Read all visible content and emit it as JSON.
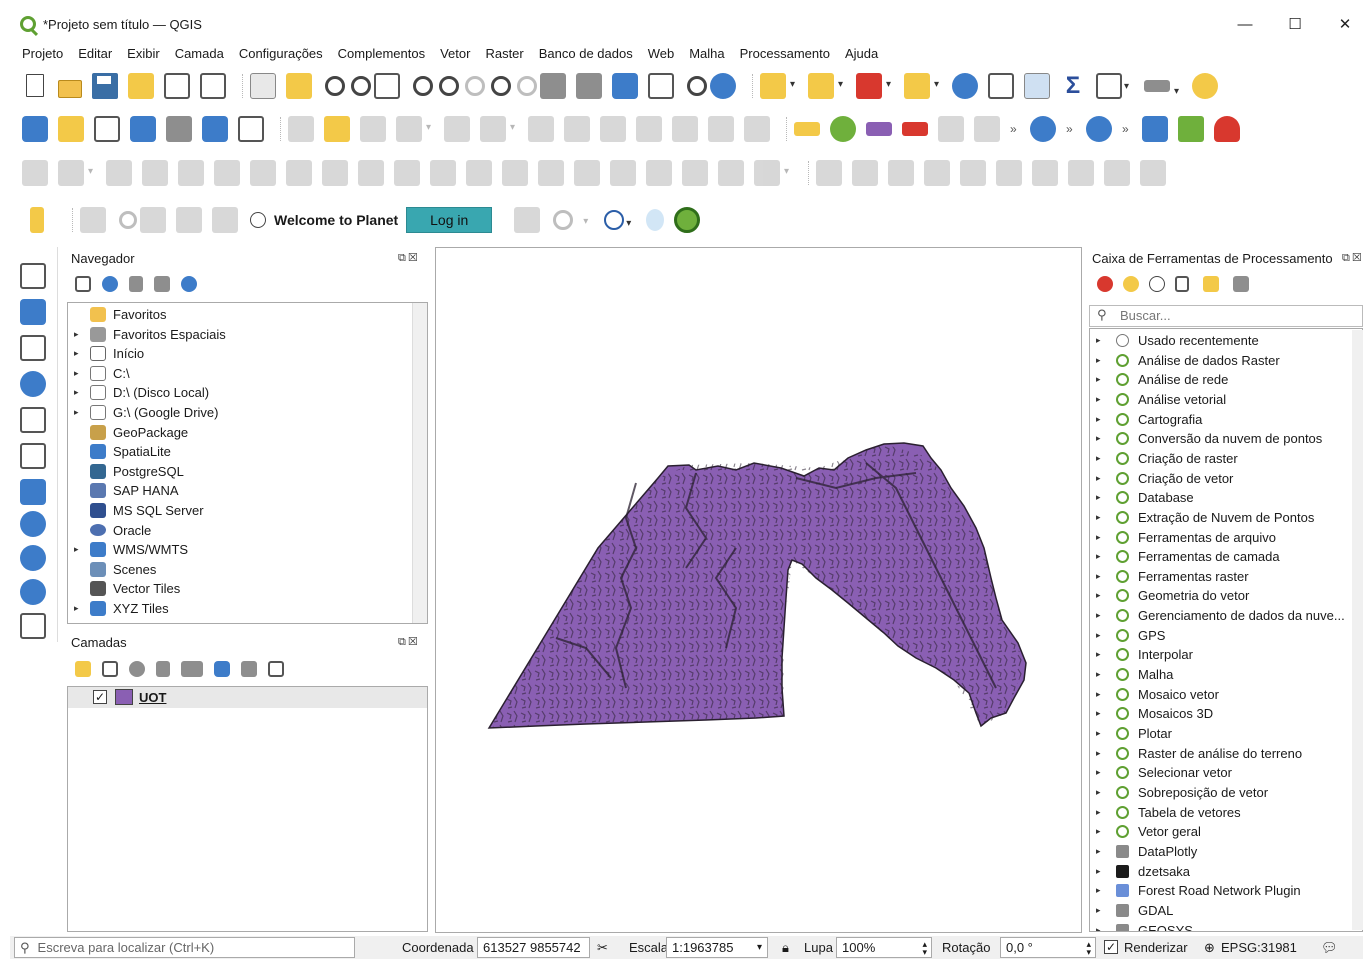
{
  "window": {
    "title": "*Projeto sem título — QGIS",
    "minimize": "—",
    "maximize": "☐",
    "close": "✕"
  },
  "menu": [
    "Projeto",
    "Editar",
    "Exibir",
    "Camada",
    "Configurações",
    "Complementos",
    "Vetor",
    "Raster",
    "Banco de dados",
    "Web",
    "Malha",
    "Processamento",
    "Ajuda"
  ],
  "planet": {
    "welcome": "Welcome to Planet",
    "login": "Log in"
  },
  "browser": {
    "title": "Navegador",
    "items": [
      {
        "label": "Favoritos",
        "arrow": "",
        "icon": "star-icon",
        "color": "#f2c14e"
      },
      {
        "label": "Favoritos Espaciais",
        "arrow": "▸",
        "icon": "spatial-bookmark-icon",
        "color": "#999999"
      },
      {
        "label": "Início",
        "arrow": "▸",
        "icon": "home-folder-icon",
        "color": "#666666"
      },
      {
        "label": "C:\\",
        "arrow": "▸",
        "icon": "folder-icon",
        "color": "#777777"
      },
      {
        "label": "D:\\ (Disco Local)",
        "arrow": "▸",
        "icon": "folder-icon",
        "color": "#777777"
      },
      {
        "label": "G:\\ (Google Drive)",
        "arrow": "▸",
        "icon": "folder-icon",
        "color": "#777777"
      },
      {
        "label": "GeoPackage",
        "arrow": "",
        "icon": "geopackage-icon",
        "color": "#c8a04a"
      },
      {
        "label": "SpatiaLite",
        "arrow": "",
        "icon": "spatialite-icon",
        "color": "#3d7cc9"
      },
      {
        "label": "PostgreSQL",
        "arrow": "",
        "icon": "postgresql-icon",
        "color": "#336791"
      },
      {
        "label": "SAP HANA",
        "arrow": "",
        "icon": "sap-hana-icon",
        "color": "#5a78b0"
      },
      {
        "label": "MS SQL Server",
        "arrow": "",
        "icon": "mssql-icon",
        "color": "#2f4f8f"
      },
      {
        "label": "Oracle",
        "arrow": "",
        "icon": "oracle-icon",
        "color": "#4d6fb0"
      },
      {
        "label": "WMS/WMTS",
        "arrow": "▸",
        "icon": "wms-globe-icon",
        "color": "#3d7cc9"
      },
      {
        "label": "Scenes",
        "arrow": "",
        "icon": "scenes-icon",
        "color": "#6c8fb8"
      },
      {
        "label": "Vector Tiles",
        "arrow": "",
        "icon": "vector-tiles-icon",
        "color": "#555555"
      },
      {
        "label": "XYZ Tiles",
        "arrow": "▸",
        "icon": "xyz-tiles-icon",
        "color": "#3d7cc9"
      }
    ]
  },
  "layers": {
    "title": "Camadas",
    "items": [
      {
        "name": "UOT",
        "checked": "✓",
        "color": "#8a5fb3"
      }
    ]
  },
  "toolbox": {
    "title": "Caixa de Ferramentas de Processamento",
    "search_placeholder": "Buscar...",
    "items": [
      {
        "label": "Usado recentemente",
        "icon": "clock-icon"
      },
      {
        "label": "Análise de dados Raster",
        "icon": "qgis-icon"
      },
      {
        "label": "Análise de rede",
        "icon": "qgis-icon"
      },
      {
        "label": "Análise vetorial",
        "icon": "qgis-icon"
      },
      {
        "label": "Cartografia",
        "icon": "qgis-icon"
      },
      {
        "label": "Conversão da nuvem de pontos",
        "icon": "qgis-icon"
      },
      {
        "label": "Criação de raster",
        "icon": "qgis-icon"
      },
      {
        "label": "Criação de vetor",
        "icon": "qgis-icon"
      },
      {
        "label": "Database",
        "icon": "qgis-icon"
      },
      {
        "label": "Extração de Nuvem de Pontos",
        "icon": "qgis-icon"
      },
      {
        "label": "Ferramentas de arquivo",
        "icon": "qgis-icon"
      },
      {
        "label": "Ferramentas de camada",
        "icon": "qgis-icon"
      },
      {
        "label": "Ferramentas raster",
        "icon": "qgis-icon"
      },
      {
        "label": "Geometria do vetor",
        "icon": "qgis-icon"
      },
      {
        "label": "Gerenciamento de dados da nuve...",
        "icon": "qgis-icon"
      },
      {
        "label": "GPS",
        "icon": "qgis-icon"
      },
      {
        "label": "Interpolar",
        "icon": "qgis-icon"
      },
      {
        "label": "Malha",
        "icon": "qgis-icon"
      },
      {
        "label": "Mosaico vetor",
        "icon": "qgis-icon"
      },
      {
        "label": "Mosaicos 3D",
        "icon": "qgis-icon"
      },
      {
        "label": "Plotar",
        "icon": "qgis-icon"
      },
      {
        "label": "Raster de análise do terreno",
        "icon": "qgis-icon"
      },
      {
        "label": "Selecionar vetor",
        "icon": "qgis-icon"
      },
      {
        "label": "Sobreposição de vetor",
        "icon": "qgis-icon"
      },
      {
        "label": "Tabela de vetores",
        "icon": "qgis-icon"
      },
      {
        "label": "Vetor geral",
        "icon": "qgis-icon"
      },
      {
        "label": "DataPlotly",
        "icon": "dataplotly-icon"
      },
      {
        "label": "dzetsaka",
        "icon": "dzetsaka-icon"
      },
      {
        "label": "Forest Road Network Plugin",
        "icon": "forest-road-icon"
      },
      {
        "label": "GDAL",
        "icon": "gdal-icon"
      },
      {
        "label": "GEOSYS",
        "icon": "geosys-icon"
      }
    ]
  },
  "status": {
    "locator_placeholder": "Escreva para localizar (Ctrl+K)",
    "coord_label": "Coordenada",
    "coord_value": "613527  9855742",
    "scale_label": "Escala",
    "scale_value": "1:1963785",
    "magnifier_label": "Lupa",
    "magnifier_value": "100%",
    "rotation_label": "Rotação",
    "rotation_value": "0,0 °",
    "render_label": "Renderizar",
    "render_checked": "✓",
    "crs": "EPSG:31981"
  },
  "colors": {
    "layer_fill": "#8a5fb3",
    "layer_detail": "#2a2030",
    "login_button": "#39a7b0",
    "qgis_green": "#5fa032"
  }
}
